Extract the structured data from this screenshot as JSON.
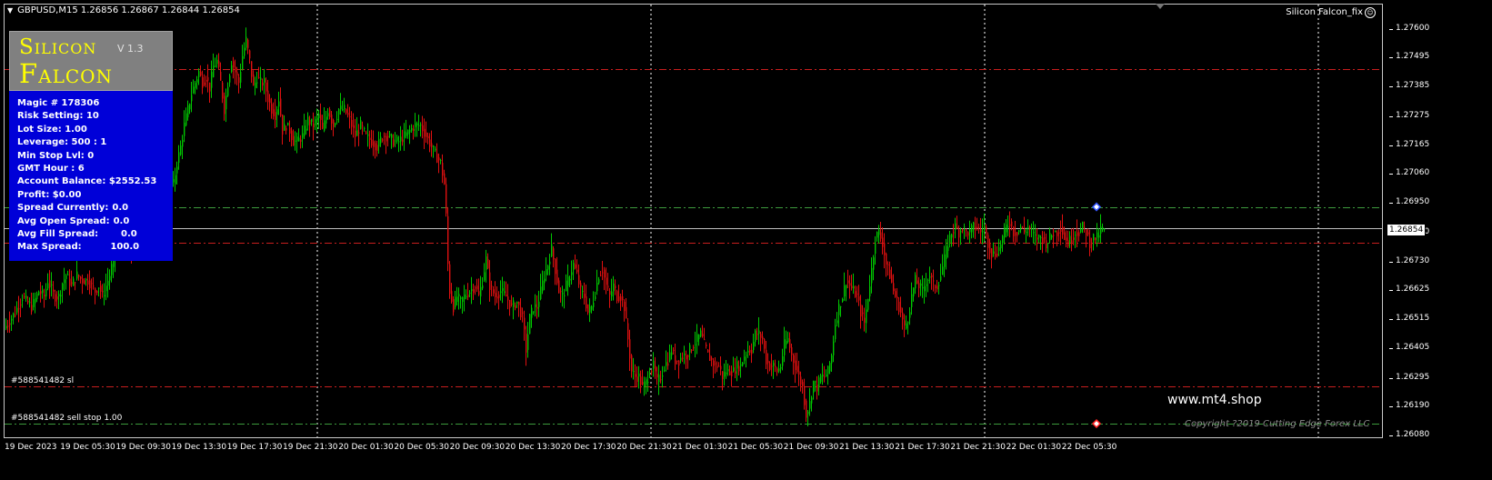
{
  "header": {
    "symbol_line": "GBPUSD,M15  1.26856 1.26867 1.26844 1.26854",
    "ea_name": "Silicon Falcon_fix",
    "smile_glyph": "☺"
  },
  "panel": {
    "title_line1": "Silicon",
    "title_line2": "Falcon",
    "version": "V 1.3",
    "rows": [
      {
        "label": "Magic # 178306",
        "value": ""
      },
      {
        "label": "Risk Setting: 10",
        "value": ""
      },
      {
        "label": "Lot Size: 1.00",
        "value": ""
      },
      {
        "label": "Leverage: 500 : 1",
        "value": ""
      },
      {
        "label": "Min Stop Lvl: 0",
        "value": ""
      },
      {
        "label": "GMT Hour : 6",
        "value": ""
      },
      {
        "label": "Account Balance: $2552.53",
        "value": ""
      },
      {
        "label": "Profit: $0.00",
        "value": ""
      },
      {
        "label": "Spread Currently:",
        "value": "0.0"
      },
      {
        "label": "Avg Open Spread:",
        "value": "0.0"
      },
      {
        "label": "Avg Fill Spread:",
        "value": "      0.0"
      },
      {
        "label": "Max Spread:",
        "value": "        100.0"
      }
    ]
  },
  "orders": {
    "sl_label": "#588541482 sl",
    "sell_stop_label": "#588541482 sell stop 1.00"
  },
  "price_axis": {
    "ticks": [
      "1.27600",
      "1.27495",
      "1.27385",
      "1.27275",
      "1.27165",
      "1.27060",
      "1.26950",
      "1.26840",
      "1.26730",
      "1.26625",
      "1.26515",
      "1.26405",
      "1.26295",
      "1.26190",
      "1.26080"
    ],
    "current_price": "1.26854"
  },
  "time_axis": {
    "ticks": [
      "19 Dec 2023",
      "19 Dec 05:30",
      "19 Dec 09:30",
      "19 Dec 13:30",
      "19 Dec 17:30",
      "19 Dec 21:30",
      "20 Dec 01:30",
      "20 Dec 05:30",
      "20 Dec 09:30",
      "20 Dec 13:30",
      "20 Dec 17:30",
      "20 Dec 21:30",
      "21 Dec 01:30",
      "21 Dec 05:30",
      "21 Dec 09:30",
      "21 Dec 13:30",
      "21 Dec 17:30",
      "21 Dec 21:30",
      "22 Dec 01:30",
      "22 Dec 05:30"
    ]
  },
  "watermark": "www.mt4.shop",
  "copyright": "Copyright ?2019 Cutting Edge Forex LLC",
  "colors": {
    "background": "#000000",
    "bull_candle": "#00c800",
    "bear_candle": "#e01010",
    "red_level": "#c81e1e",
    "green_level": "#3c9a3c",
    "period_sep": "#ffffff",
    "panel_blue": "#0000d8",
    "title_yellow": "#ffff00"
  },
  "chart_data": {
    "type": "candlestick",
    "symbol": "GBPUSD",
    "timeframe": "M15",
    "ylim": [
      1.2602,
      1.2766
    ],
    "levels": [
      {
        "price": 1.27452,
        "color": "red"
      },
      {
        "price": 1.26935,
        "color": "green"
      },
      {
        "price": 1.268,
        "color": "red"
      },
      {
        "price": 1.26262,
        "color": "red"
      },
      {
        "price": 1.26124,
        "color": "green"
      }
    ],
    "current_price": 1.26854,
    "path": [
      [
        0,
        1.2648
      ],
      [
        12,
        1.2654
      ],
      [
        20,
        1.266
      ],
      [
        30,
        1.2656
      ],
      [
        38,
        1.2662
      ],
      [
        44,
        1.266
      ],
      [
        48,
        1.2666
      ],
      [
        55,
        1.266
      ],
      [
        60,
        1.266
      ],
      [
        64,
        1.2665
      ],
      [
        68,
        1.2668
      ],
      [
        74,
        1.2664
      ],
      [
        80,
        1.2668
      ],
      [
        86,
        1.2666
      ],
      [
        92,
        1.2666
      ],
      [
        100,
        1.2662
      ],
      [
        104,
        1.2664
      ],
      [
        108,
        1.266
      ],
      [
        112,
        1.2664
      ],
      [
        116,
        1.2668
      ],
      [
        120,
        1.2674
      ],
      [
        126,
        1.2682
      ],
      [
        132,
        1.2676
      ],
      [
        140,
        1.2676
      ],
      [
        146,
        1.2682
      ],
      [
        152,
        1.2688
      ],
      [
        158,
        1.2692
      ],
      [
        164,
        1.27
      ],
      [
        170,
        1.2704
      ],
      [
        176,
        1.2704
      ],
      [
        180,
        1.2704
      ],
      [
        186,
        1.2702
      ],
      [
        190,
        1.271
      ],
      [
        194,
        1.2716
      ],
      [
        198,
        1.2724
      ],
      [
        202,
        1.273
      ],
      [
        206,
        1.2736
      ],
      [
        210,
        1.274
      ],
      [
        214,
        1.2744
      ],
      [
        218,
        1.274
      ],
      [
        222,
        1.2742
      ],
      [
        226,
        1.2738
      ],
      [
        230,
        1.2746
      ],
      [
        234,
        1.2748
      ],
      [
        238,
        1.274
      ],
      [
        242,
        1.273
      ],
      [
        246,
        1.274
      ],
      [
        250,
        1.2748
      ],
      [
        254,
        1.2744
      ],
      [
        258,
        1.274
      ],
      [
        262,
        1.275
      ],
      [
        266,
        1.2756
      ],
      [
        270,
        1.2748
      ],
      [
        274,
        1.2738
      ],
      [
        278,
        1.2742
      ],
      [
        282,
        1.274
      ],
      [
        286,
        1.274
      ],
      [
        290,
        1.2734
      ],
      [
        294,
        1.273
      ],
      [
        298,
        1.2728
      ],
      [
        302,
        1.2734
      ],
      [
        306,
        1.2722
      ],
      [
        310,
        1.2724
      ],
      [
        314,
        1.2722
      ],
      [
        318,
        1.2718
      ],
      [
        322,
        1.2718
      ],
      [
        328,
        1.272
      ],
      [
        334,
        1.2726
      ],
      [
        340,
        1.2724
      ],
      [
        346,
        1.2728
      ],
      [
        350,
        1.2722
      ],
      [
        356,
        1.273
      ],
      [
        362,
        1.2724
      ],
      [
        368,
        1.273
      ],
      [
        374,
        1.273
      ],
      [
        380,
        1.2726
      ],
      [
        386,
        1.272
      ],
      [
        392,
        1.2724
      ],
      [
        398,
        1.272
      ],
      [
        404,
        1.2718
      ],
      [
        410,
        1.2716
      ],
      [
        416,
        1.272
      ],
      [
        422,
        1.272
      ],
      [
        428,
        1.2718
      ],
      [
        434,
        1.2718
      ],
      [
        440,
        1.272
      ],
      [
        446,
        1.2722
      ],
      [
        452,
        1.2724
      ],
      [
        458,
        1.2724
      ],
      [
        464,
        1.272
      ],
      [
        470,
        1.2716
      ],
      [
        476,
        1.2712
      ],
      [
        480,
        1.271
      ],
      [
        484,
        1.2702
      ],
      [
        486,
        1.269
      ],
      [
        488,
        1.2672
      ],
      [
        490,
        1.2662
      ],
      [
        494,
        1.2656
      ],
      [
        498,
        1.266
      ],
      [
        502,
        1.2658
      ],
      [
        506,
        1.266
      ],
      [
        512,
        1.2662
      ],
      [
        518,
        1.2664
      ],
      [
        522,
        1.266
      ],
      [
        526,
        1.2666
      ],
      [
        530,
        1.2674
      ],
      [
        534,
        1.2664
      ],
      [
        540,
        1.266
      ],
      [
        546,
        1.2662
      ],
      [
        552,
        1.266
      ],
      [
        558,
        1.2656
      ],
      [
        564,
        1.2658
      ],
      [
        570,
        1.2652
      ],
      [
        574,
        1.264
      ],
      [
        578,
        1.2652
      ],
      [
        582,
        1.2656
      ],
      [
        586,
        1.2656
      ],
      [
        590,
        1.2662
      ],
      [
        594,
        1.2668
      ],
      [
        598,
        1.2672
      ],
      [
        602,
        1.2678
      ],
      [
        606,
        1.267
      ],
      [
        610,
        1.2662
      ],
      [
        614,
        1.266
      ],
      [
        618,
        1.2664
      ],
      [
        622,
        1.2668
      ],
      [
        626,
        1.2672
      ],
      [
        630,
        1.2668
      ],
      [
        634,
        1.2662
      ],
      [
        638,
        1.266
      ],
      [
        642,
        1.2654
      ],
      [
        646,
        1.2656
      ],
      [
        650,
        1.2662
      ],
      [
        654,
        1.2668
      ],
      [
        658,
        1.267
      ],
      [
        662,
        1.2664
      ],
      [
        666,
        1.266
      ],
      [
        670,
        1.2664
      ],
      [
        674,
        1.266
      ],
      [
        678,
        1.266
      ],
      [
        682,
        1.2656
      ],
      [
        686,
        1.2644
      ],
      [
        690,
        1.2632
      ],
      [
        694,
        1.263
      ],
      [
        698,
        1.263
      ],
      [
        702,
        1.2626
      ],
      [
        706,
        1.2628
      ],
      [
        710,
        1.2632
      ],
      [
        714,
        1.2634
      ],
      [
        718,
        1.2628
      ],
      [
        722,
        1.263
      ],
      [
        726,
        1.2634
      ],
      [
        730,
        1.2636
      ],
      [
        734,
        1.264
      ],
      [
        738,
        1.2636
      ],
      [
        742,
        1.2636
      ],
      [
        746,
        1.2638
      ],
      [
        750,
        1.2638
      ],
      [
        754,
        1.264
      ],
      [
        758,
        1.2642
      ],
      [
        762,
        1.2644
      ],
      [
        766,
        1.2646
      ],
      [
        770,
        1.2642
      ],
      [
        774,
        1.2638
      ],
      [
        778,
        1.2636
      ],
      [
        782,
        1.2634
      ],
      [
        786,
        1.2634
      ],
      [
        790,
        1.263
      ],
      [
        794,
        1.2632
      ],
      [
        798,
        1.2632
      ],
      [
        802,
        1.2632
      ],
      [
        806,
        1.2634
      ],
      [
        810,
        1.2634
      ],
      [
        814,
        1.2638
      ],
      [
        818,
        1.264
      ],
      [
        822,
        1.264
      ],
      [
        826,
        1.2646
      ],
      [
        830,
        1.2646
      ],
      [
        834,
        1.2644
      ],
      [
        838,
        1.2636
      ],
      [
        842,
        1.2634
      ],
      [
        846,
        1.2634
      ],
      [
        850,
        1.2632
      ],
      [
        854,
        1.2634
      ],
      [
        858,
        1.2642
      ],
      [
        862,
        1.2644
      ],
      [
        866,
        1.2638
      ],
      [
        870,
        1.2634
      ],
      [
        874,
        1.263
      ],
      [
        878,
        1.2626
      ],
      [
        882,
        1.2616
      ],
      [
        886,
        1.262
      ],
      [
        890,
        1.2628
      ],
      [
        894,
        1.2626
      ],
      [
        898,
        1.263
      ],
      [
        902,
        1.263
      ],
      [
        906,
        1.2632
      ],
      [
        910,
        1.2638
      ],
      [
        914,
        1.265
      ],
      [
        918,
        1.2656
      ],
      [
        922,
        1.266
      ],
      [
        926,
        1.2666
      ],
      [
        930,
        1.2664
      ],
      [
        934,
        1.2662
      ],
      [
        938,
        1.266
      ],
      [
        942,
        1.2654
      ],
      [
        946,
        1.265
      ],
      [
        950,
        1.266
      ],
      [
        954,
        1.267
      ],
      [
        958,
        1.2682
      ],
      [
        962,
        1.2684
      ],
      [
        966,
        1.268
      ],
      [
        970,
        1.2672
      ],
      [
        974,
        1.2668
      ],
      [
        978,
        1.2662
      ],
      [
        982,
        1.2658
      ],
      [
        986,
        1.2654
      ],
      [
        990,
        1.2648
      ],
      [
        994,
        1.2652
      ],
      [
        998,
        1.266
      ],
      [
        1002,
        1.2666
      ],
      [
        1006,
        1.2664
      ],
      [
        1010,
        1.2662
      ],
      [
        1014,
        1.2666
      ],
      [
        1018,
        1.2668
      ],
      [
        1022,
        1.2664
      ],
      [
        1026,
        1.2664
      ],
      [
        1030,
        1.2668
      ],
      [
        1034,
        1.2674
      ],
      [
        1038,
        1.268
      ],
      [
        1042,
        1.2684
      ],
      [
        1046,
        1.2686
      ],
      [
        1050,
        1.2684
      ],
      [
        1054,
        1.2686
      ],
      [
        1058,
        1.2684
      ],
      [
        1062,
        1.2684
      ],
      [
        1066,
        1.2686
      ],
      [
        1070,
        1.2686
      ],
      [
        1074,
        1.2684
      ],
      [
        1078,
        1.2686
      ],
      [
        1082,
        1.268
      ],
      [
        1086,
        1.2676
      ],
      [
        1090,
        1.2676
      ],
      [
        1094,
        1.2678
      ],
      [
        1098,
        1.2682
      ],
      [
        1102,
        1.2686
      ],
      [
        1106,
        1.2688
      ],
      [
        1110,
        1.2684
      ],
      [
        1114,
        1.2684
      ],
      [
        1118,
        1.2686
      ],
      [
        1122,
        1.2684
      ],
      [
        1126,
        1.2686
      ],
      [
        1130,
        1.2684
      ],
      [
        1134,
        1.2682
      ],
      [
        1138,
        1.2682
      ],
      [
        1142,
        1.2682
      ],
      [
        1146,
        1.268
      ],
      [
        1150,
        1.2682
      ],
      [
        1154,
        1.2684
      ],
      [
        1158,
        1.2684
      ],
      [
        1162,
        1.2686
      ],
      [
        1166,
        1.2682
      ],
      [
        1170,
        1.268
      ],
      [
        1174,
        1.2682
      ],
      [
        1178,
        1.2684
      ],
      [
        1182,
        1.2684
      ],
      [
        1186,
        1.2686
      ],
      [
        1190,
        1.2684
      ],
      [
        1194,
        1.268
      ],
      [
        1198,
        1.2682
      ],
      [
        1202,
        1.2682
      ],
      [
        1206,
        1.2685
      ],
      [
        1208,
        1.2685
      ]
    ]
  }
}
